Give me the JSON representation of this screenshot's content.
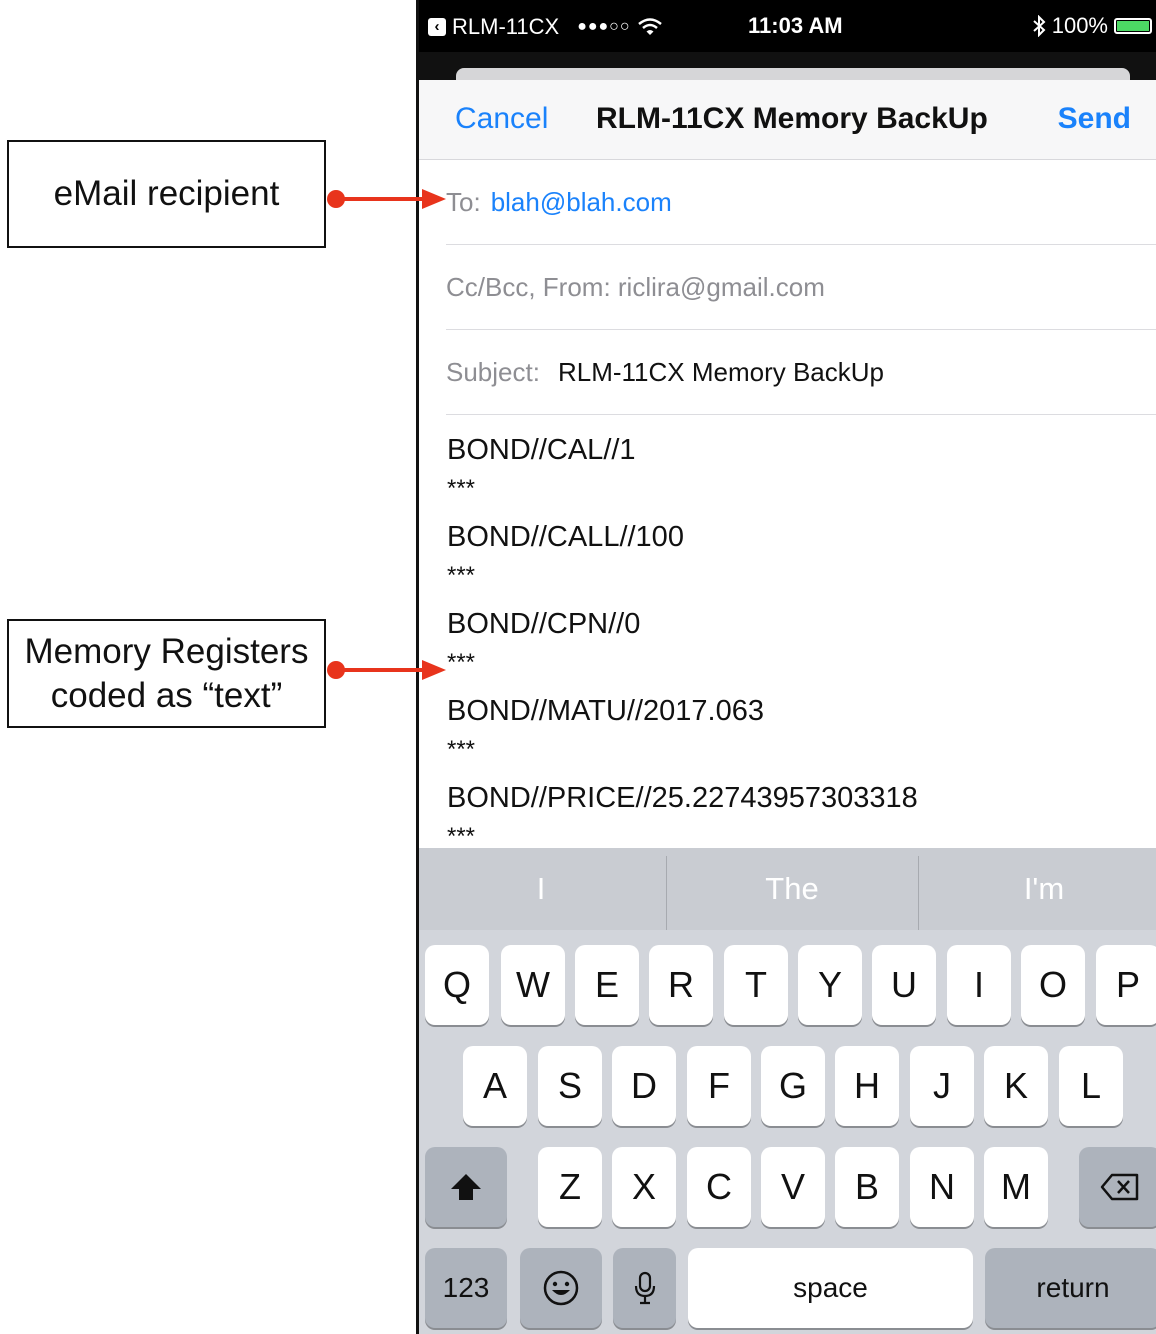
{
  "annotations": {
    "recipient_label": "eMail recipient",
    "registers_line1": "Memory Registers",
    "registers_line2": "coded as “text”",
    "arrow_color": "#e8341c"
  },
  "status_bar": {
    "back_app": "RLM-11CX",
    "signal": "●●●○○",
    "wifi_icon": "wifi-icon",
    "time": "11:03 AM",
    "bluetooth_icon": "bluetooth-icon",
    "battery": "100%"
  },
  "nav": {
    "cancel": "Cancel",
    "title": "RLM-11CX Memory BackUp",
    "send": "Send"
  },
  "fields": {
    "to_label": "To:",
    "to_value": "blah@blah.com",
    "cc_text": "Cc/Bcc, From:  riclira@gmail.com",
    "subject_label": "Subject:",
    "subject_value": "RLM-11CX Memory BackUp"
  },
  "body": {
    "lines": [
      "BOND//CAL//1",
      "BOND//CALL//100",
      "BOND//CPN//0",
      "BOND//MATU//2017.063",
      "BOND//PRICE//25.22743957303318"
    ],
    "separator": "***"
  },
  "keyboard": {
    "predictions": [
      "I",
      "The",
      "I'm"
    ],
    "row1": [
      "Q",
      "W",
      "E",
      "R",
      "T",
      "Y",
      "U",
      "I",
      "O",
      "P"
    ],
    "row2": [
      "A",
      "S",
      "D",
      "F",
      "G",
      "H",
      "J",
      "K",
      "L"
    ],
    "row3": [
      "Z",
      "X",
      "C",
      "V",
      "B",
      "N",
      "M"
    ],
    "shift_icon": "shift-icon",
    "delete_icon": "delete-icon",
    "numbers": "123",
    "emoji_icon": "emoji-icon",
    "mic_icon": "microphone-icon",
    "space": "space",
    "return": "return"
  }
}
